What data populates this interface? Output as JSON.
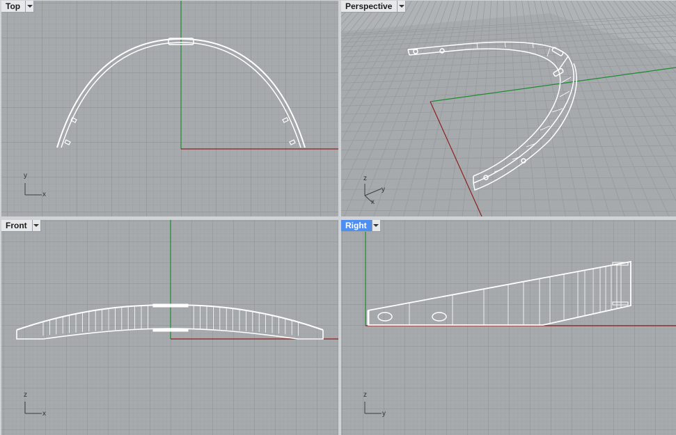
{
  "viewports": [
    {
      "id": "top",
      "title": "Top",
      "active": false,
      "axis_labels": [
        "y",
        "x"
      ]
    },
    {
      "id": "perspective",
      "title": "Perspective",
      "active": false,
      "axis_labels": [
        "z",
        "y",
        "x"
      ]
    },
    {
      "id": "front",
      "title": "Front",
      "active": false,
      "axis_labels": [
        "z",
        "x"
      ]
    },
    {
      "id": "right",
      "title": "Right",
      "active": true,
      "axis_labels": [
        "z",
        "y"
      ]
    }
  ],
  "colors": {
    "viewport_bg": "#a7aaad",
    "grid_minor": "#9b9ea2",
    "grid_major": "#8b8e92",
    "x_axis": "#8c1f1f",
    "y_axis": "#1d8a2e",
    "model": "#ffffff",
    "active_tab": "#4d8ef0"
  },
  "icons": {
    "dropdown": "chevron-down-icon"
  }
}
